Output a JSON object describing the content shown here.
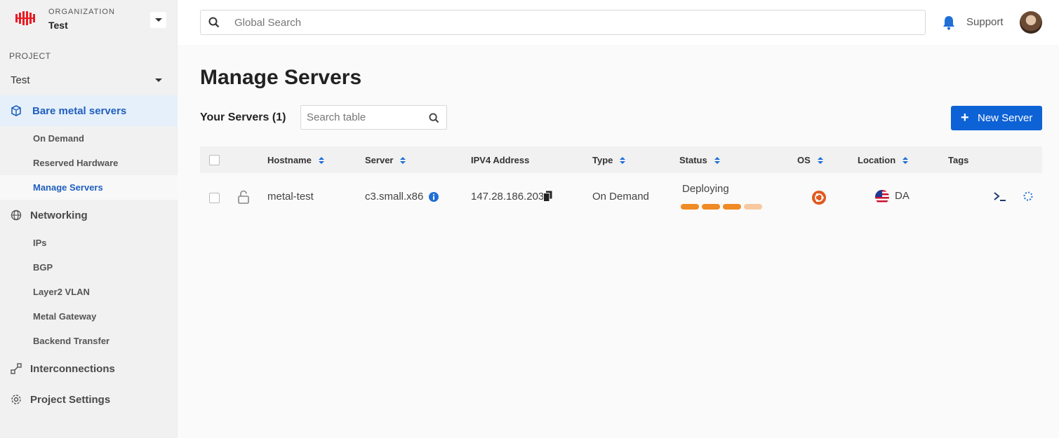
{
  "org": {
    "label": "ORGANIZATION",
    "name": "Test"
  },
  "project": {
    "label": "PROJECT",
    "name": "Test"
  },
  "sidebar": {
    "bare_metal": "Bare metal servers",
    "bare_metal_items": [
      "On Demand",
      "Reserved Hardware",
      "Manage Servers"
    ],
    "networking": "Networking",
    "networking_items": [
      "IPs",
      "BGP",
      "Layer2 VLAN",
      "Metal Gateway",
      "Backend Transfer"
    ],
    "interconnections": "Interconnections",
    "project_settings": "Project Settings"
  },
  "topbar": {
    "search_placeholder": "Global Search",
    "support": "Support"
  },
  "page": {
    "title": "Manage Servers",
    "servers_title": "Your Servers (1)",
    "table_search_placeholder": "Search table",
    "new_server": "New Server"
  },
  "table": {
    "headers": [
      "Hostname",
      "Server",
      "IPV4 Address",
      "Type",
      "Status",
      "OS",
      "Location",
      "Tags"
    ],
    "rows": [
      {
        "hostname": "metal-test",
        "server": "c3.small.x86",
        "ipv4": "147.28.186.203",
        "type": "On Demand",
        "status": "Deploying",
        "status_progress": 0.75,
        "location": "DA"
      }
    ]
  },
  "colors": {
    "accent": "#0d62d6",
    "status": "#f08a24",
    "brand": "#e91c24"
  }
}
